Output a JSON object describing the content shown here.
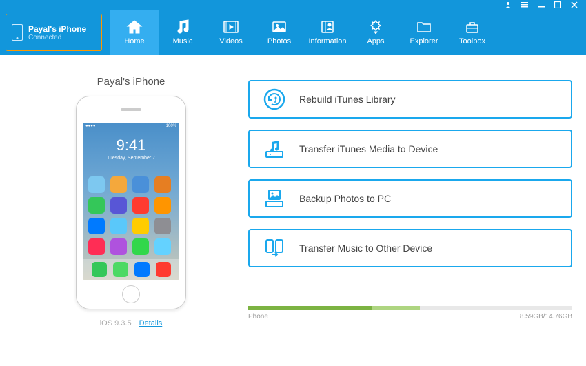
{
  "titlebar": {
    "user_icon": "user-icon",
    "menu_icon": "menu-icon",
    "minimize_icon": "minimize-icon",
    "maximize_icon": "maximize-icon",
    "close_icon": "close-icon"
  },
  "device": {
    "name": "Payal's iPhone",
    "status": "Connected"
  },
  "nav": [
    {
      "label": "Home",
      "icon": "home-icon",
      "active": true
    },
    {
      "label": "Music",
      "icon": "music-icon",
      "active": false
    },
    {
      "label": "Videos",
      "icon": "video-icon",
      "active": false
    },
    {
      "label": "Photos",
      "icon": "photo-icon",
      "active": false
    },
    {
      "label": "Information",
      "icon": "info-icon",
      "active": false
    },
    {
      "label": "Apps",
      "icon": "apps-icon",
      "active": false
    },
    {
      "label": "Explorer",
      "icon": "folder-icon",
      "active": false
    },
    {
      "label": "Toolbox",
      "icon": "toolbox-icon",
      "active": false
    }
  ],
  "phone": {
    "title": "Payal's iPhone",
    "clock": "9:41",
    "date": "Tuesday, September 7",
    "version": "iOS 9.3.5",
    "details_label": "Details",
    "app_colors": [
      "#7dc8f0",
      "#f4a83c",
      "#4a90d9",
      "#e67e22",
      "#34c759",
      "#5856d6",
      "#ff3b30",
      "#ff9500",
      "#007aff",
      "#5ac8fa",
      "#ffcc00",
      "#8e8e93",
      "#ff2d55",
      "#af52de",
      "#32d74b",
      "#64d2ff"
    ],
    "dock_colors": [
      "#34c759",
      "#4cd964",
      "#007aff",
      "#ff3b30"
    ]
  },
  "actions": [
    {
      "label": "Rebuild iTunes Library",
      "icon": "rebuild-icon"
    },
    {
      "label": "Transfer iTunes Media to Device",
      "icon": "transfer-media-icon"
    },
    {
      "label": "Backup Photos to PC",
      "icon": "backup-photos-icon"
    },
    {
      "label": "Transfer Music to Other Device",
      "icon": "transfer-music-icon"
    }
  ],
  "storage": {
    "label": "Phone",
    "used_text": "8.59GB/14.76GB",
    "seg1_pct": 38,
    "seg2_pct": 15
  }
}
